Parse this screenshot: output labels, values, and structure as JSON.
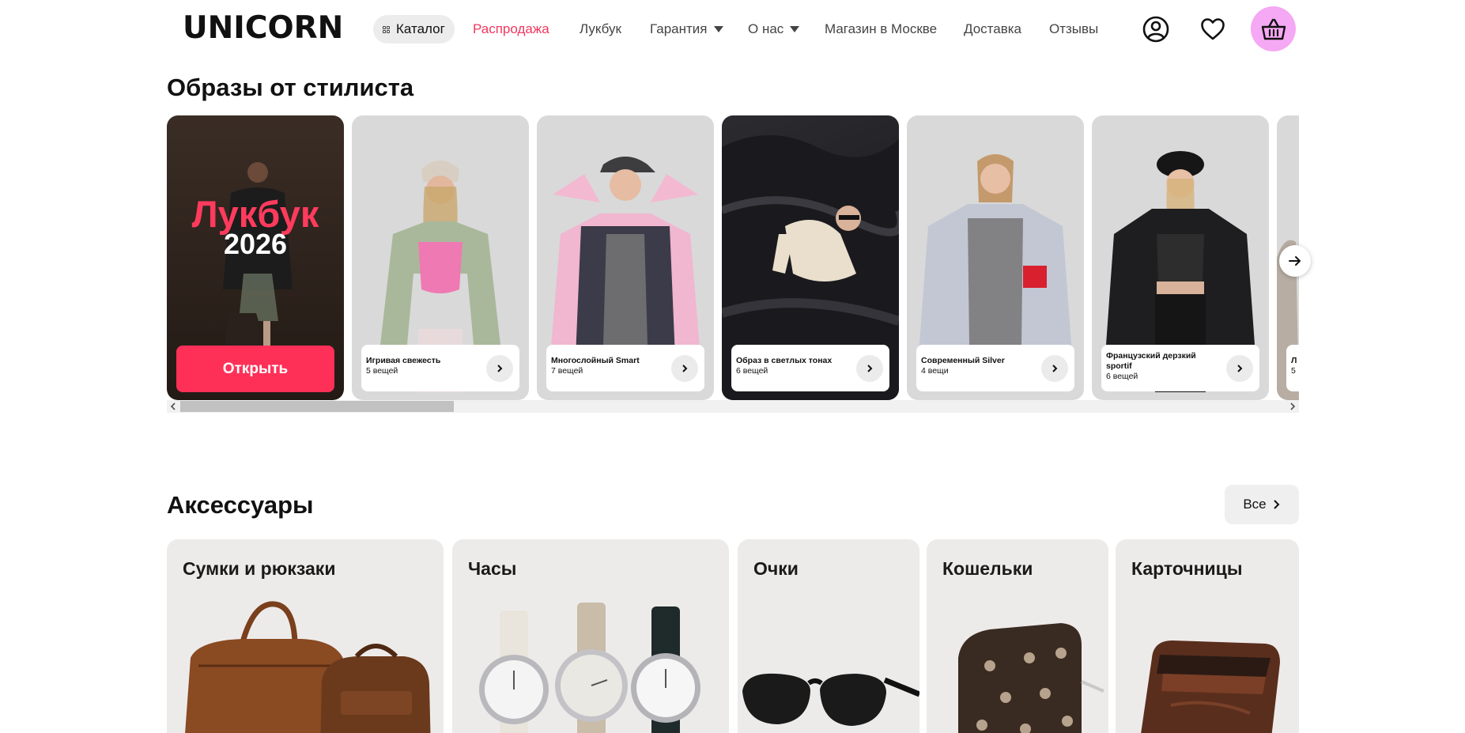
{
  "header": {
    "logo": "UNICORN",
    "catalog_label": "Каталог",
    "nav": {
      "sale": "Распродажа",
      "lookbook": "Лукбук",
      "warranty": "Гарантия",
      "about": "О нас",
      "store": "Магазин в Москве",
      "delivery": "Доставка",
      "reviews": "Отзывы"
    },
    "icons": {
      "account": "user-circle-icon",
      "favorites": "heart-icon",
      "cart": "basket-icon"
    },
    "colors": {
      "sale": "#f0385e",
      "cart_bg": "#f5a8f3"
    }
  },
  "looks": {
    "title": "Образы от стилиста",
    "promo": {
      "title": "Лукбук",
      "year": "2026",
      "button": "Открыть"
    },
    "cards": [
      {
        "name": "Игривая свежесть",
        "count": "5 вещей"
      },
      {
        "name": "Многослойный Smart",
        "count": "7 вещей"
      },
      {
        "name": "Образ в светлых тонах",
        "count": "6 вещей"
      },
      {
        "name": "Современный Silver",
        "count": "4 вещи"
      },
      {
        "name": "Французский дерзкий sportif",
        "count": "6 вещей"
      },
      {
        "name": "Л",
        "count": "5"
      }
    ],
    "accent": "#ff3058"
  },
  "accessories": {
    "title": "Аксессуары",
    "all_label": "Все",
    "categories": [
      {
        "name": "Сумки и рюкзаки"
      },
      {
        "name": "Часы"
      },
      {
        "name": "Очки"
      },
      {
        "name": "Кошельки"
      },
      {
        "name": "Карточницы"
      }
    ]
  }
}
